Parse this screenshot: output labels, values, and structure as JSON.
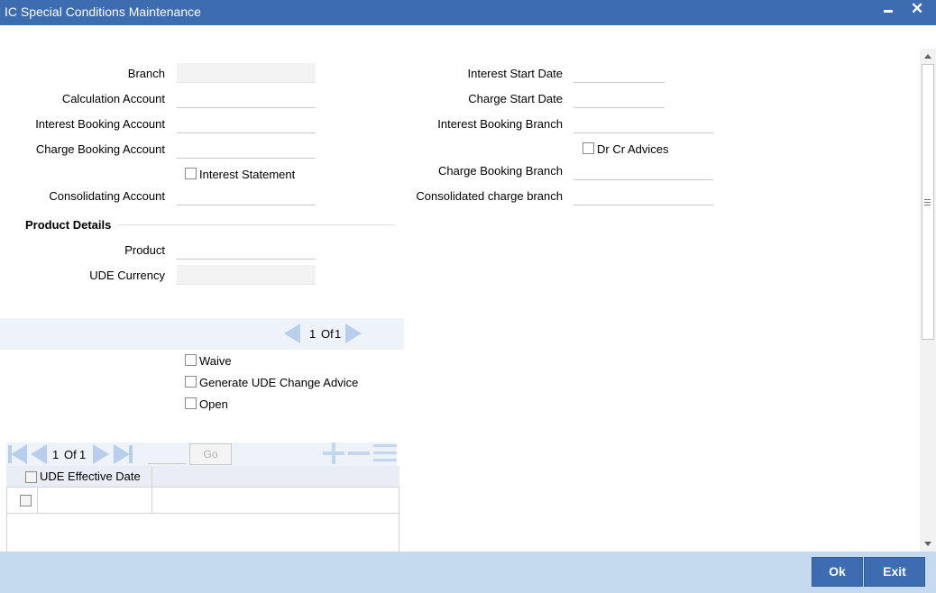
{
  "window": {
    "title": "IC Special Conditions Maintenance"
  },
  "form": {
    "branch_label": "Branch",
    "calc_account_label": "Calculation Account",
    "int_booking_account_label": "Interest Booking Account",
    "charge_booking_account_label": "Charge Booking Account",
    "interest_statement_label": "Interest Statement",
    "consolidating_account_label": "Consolidating Account",
    "interest_start_date_label": "Interest Start Date",
    "charge_start_date_label": "Charge Start Date",
    "interest_booking_branch_label": "Interest Booking Branch",
    "dr_cr_advices_label": "Dr Cr Advices",
    "charge_booking_branch_label": "Charge Booking Branch",
    "consolidated_charge_branch_label": "Consolidated charge branch"
  },
  "product": {
    "section_title": "Product Details",
    "product_label": "Product",
    "ude_currency_label": "UDE Currency"
  },
  "pager1": {
    "current": "1",
    "of_text": "Of",
    "total": "1"
  },
  "options": {
    "waive_label": "Waive",
    "generate_ude_label": "Generate UDE Change Advice",
    "open_label": "Open"
  },
  "grid": {
    "pager_current": "1",
    "pager_of": "Of",
    "pager_total": "1",
    "go_label": "Go",
    "column_header": "UDE Effective Date"
  },
  "footer": {
    "ok_label": "Ok",
    "exit_label": "Exit"
  },
  "colors": {
    "title_bar": "#3d6db0",
    "footer_bg": "#c5d9ef",
    "button_bg": "#3d6db0"
  }
}
